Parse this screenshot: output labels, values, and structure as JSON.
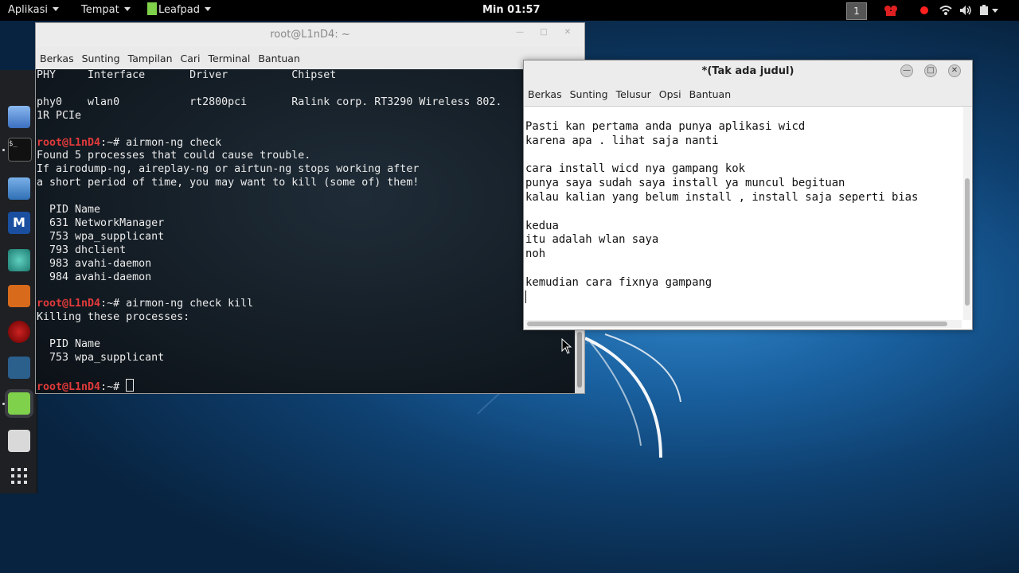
{
  "topbar": {
    "applications": "Aplikasi",
    "places": "Tempat",
    "active_app": "Leafpad",
    "clock": "Min 01:57",
    "workspace": "1"
  },
  "dock": {
    "items": [
      "pidgin-icon",
      "terminal-icon",
      "files-icon",
      "metasploit-icon",
      "avatar-app-icon",
      "burpsuite-icon",
      "armitage-icon",
      "maltego-icon",
      "leafpad-icon",
      "cherrytree-icon",
      "show-apps-icon"
    ]
  },
  "terminal": {
    "title": "root@L1nD4: ~",
    "menu": [
      "Berkas",
      "Sunting",
      "Tampilan",
      "Cari",
      "Terminal",
      "Bantuan"
    ],
    "lines": {
      "l1": "PHY\tInterface\tDriver\t\tChipset",
      "l2": "",
      "l3": "phy0\twlan0\t\trt2800pci\tRalink corp. RT3290 Wireless 802.",
      "l4": "1R PCIe",
      "l5": "",
      "l6_prompt": "root@L1nD4",
      "l6_cmd": ":~# airmon-ng check",
      "l7": "Found 5 processes that could cause trouble.",
      "l8": "If airodump-ng, aireplay-ng or airtun-ng stops working after",
      "l9": "a short period of time, you may want to kill (some of) them!",
      "l10": "",
      "l11": "  PID Name",
      "l12": "  631 NetworkManager",
      "l13": "  753 wpa_supplicant",
      "l14": "  793 dhclient",
      "l15": "  983 avahi-daemon",
      "l16": "  984 avahi-daemon",
      "l17": "",
      "l18_prompt": "root@L1nD4",
      "l18_cmd": ":~# airmon-ng check kill",
      "l19": "Killing these processes:",
      "l20": "",
      "l21": "  PID Name",
      "l22": "  753 wpa_supplicant",
      "l23": "",
      "l24_prompt": "root@L1nD4",
      "l24_cmd": ":~# "
    }
  },
  "leafpad": {
    "title": "*(Tak ada judul)",
    "menu": [
      "Berkas",
      "Sunting",
      "Telusur",
      "Opsi",
      "Bantuan"
    ],
    "lines": [
      "Pasti kan pertama anda punya aplikasi wicd",
      "karena apa . lihat saja nanti",
      "",
      "cara install wicd nya gampang kok",
      "punya saya sudah saya install ya muncul begituan",
      "kalau kalian yang belum install , install saja seperti bias",
      "",
      "kedua",
      "itu adalah wlan saya",
      "noh",
      "",
      "kemudian cara fixnya gampang",
      ""
    ]
  },
  "colors": {
    "prompt": "#e23a3a",
    "desktop": "#19609f",
    "topbar": "#000000",
    "dock": "#1e2024"
  }
}
